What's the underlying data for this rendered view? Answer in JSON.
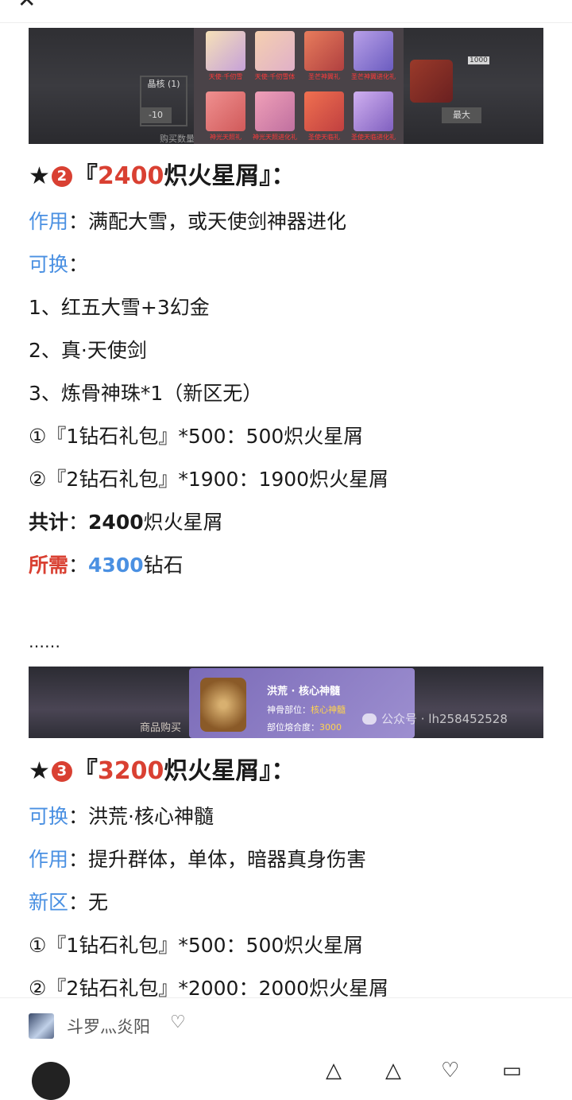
{
  "topbar": {
    "close_icon": "close-icon"
  },
  "banner1": {
    "side_label": "晶核 (1)",
    "minus_label": "-10",
    "right_btn_label": "最大",
    "bottom_text": "购买数量",
    "counter": "1000",
    "items": [
      {
        "caption": "天使·千仞雪",
        "icon": "character-portrait"
      },
      {
        "caption": "天使·千仞雪体",
        "icon": "character-portrait"
      },
      {
        "caption": "圣芒神翼礼",
        "icon": "armor-icon"
      },
      {
        "caption": "圣芒神翼进化礼",
        "icon": "armor-icon"
      },
      {
        "caption": "神光天照礼",
        "icon": "armor-icon"
      },
      {
        "caption": "神光天照进化礼",
        "icon": "armor-icon"
      },
      {
        "caption": "圣使天临礼",
        "icon": "armor-icon"
      },
      {
        "caption": "圣使天临进化礼",
        "icon": "armor-icon"
      }
    ]
  },
  "section2": {
    "star": "★",
    "num": "2",
    "title_open": "『",
    "title_number": "2400",
    "title_text": "炽火星屑",
    "title_close": "』：",
    "effect_label": "作用",
    "effect_text": "：满配大雪，或天使剑神器进化",
    "exchange_label": "可换",
    "exchange_colon": "：",
    "list1": "1、红五大雪+3幻金",
    "list2": "2、真·天使剑",
    "list3": "3、炼骨神珠*1（新区无）",
    "pack1": "①『1钻石礼包』*500：500炽火星屑",
    "pack2": "②『2钻石礼包』*1900：1900炽火星屑",
    "total_label": "共计",
    "total_colon": "：",
    "total_value": "2400",
    "total_unit": "炽火星屑",
    "need_label": "所需",
    "need_colon": "：",
    "need_value": "4300",
    "need_unit": "钻石"
  },
  "ellipsis": "……",
  "banner2": {
    "item_name": "洪荒 · 核心神髓",
    "line1_label": "神骨部位：",
    "line1_value": "核心神髓",
    "line2_label": "部位熔合度：",
    "line2_value": "3000",
    "shop_text": "商品购买",
    "watermark": "公众号 · lh258452528"
  },
  "section3": {
    "star": "★",
    "num": "3",
    "title_open": "『",
    "title_number": "3200",
    "title_text": "炽火星屑",
    "title_close": "』：",
    "exchange_label": "可换",
    "exchange_text": "：洪荒·核心神髓",
    "effect_label": "作用",
    "effect_text": "：提升群体，单体，暗器真身伤害",
    "new_label": "新区",
    "new_text": "：无",
    "pack1": "①『1钻石礼包』*500：500炽火星屑",
    "pack2": "②『2钻石礼包』*2000：2000炽火星屑"
  },
  "bottombar": {
    "author": "斗罗灬炎阳",
    "heart": "♡"
  },
  "colors": {
    "blue": "#4a90e2",
    "red": "#d94032"
  }
}
